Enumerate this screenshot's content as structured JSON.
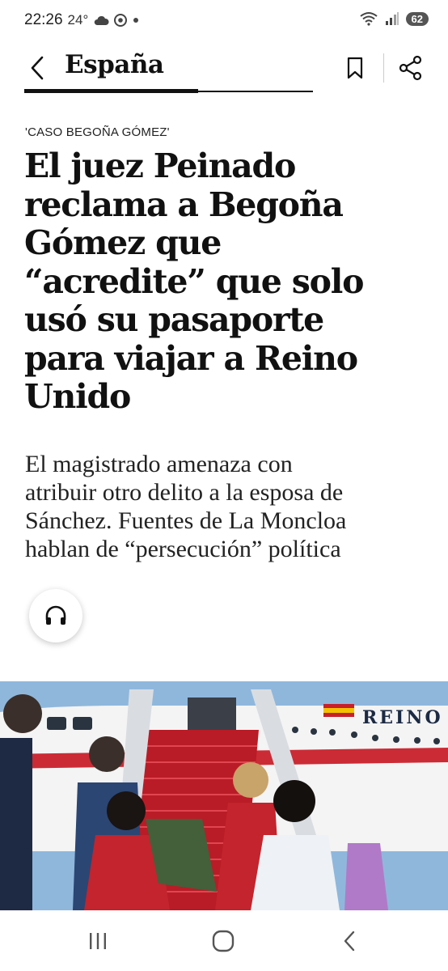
{
  "status_bar": {
    "time": "22:26",
    "temperature": "24°",
    "battery": "62"
  },
  "header": {
    "section": "España"
  },
  "article": {
    "kicker": "'CASO BEGOÑA GÓMEZ'",
    "headline_lines": [
      "El juez Peinado",
      "reclama a Begoña",
      "Gómez que",
      "“acredite” que solo",
      "usó su pasaporte",
      "para viajar a Reino",
      "Unido"
    ],
    "subtitle_lines": [
      "El magistrado amenaza con",
      "atribuir otro delito a la esposa de",
      "Sánchez. Fuentes de La Moncloa",
      "hablan de “persecución” política"
    ]
  },
  "photo": {
    "plane_text": "REINO"
  },
  "icons": {
    "back": "chevron-left-icon",
    "bookmark": "bookmark-icon",
    "share": "share-icon",
    "listen": "headphones-icon",
    "nav_recents": "recents-icon",
    "nav_home": "home-icon",
    "nav_back": "back-icon"
  },
  "colors": {
    "text": "#111111",
    "background": "#ffffff",
    "carpet_red": "#c8202a",
    "sky_blue": "#8fb7dc"
  }
}
